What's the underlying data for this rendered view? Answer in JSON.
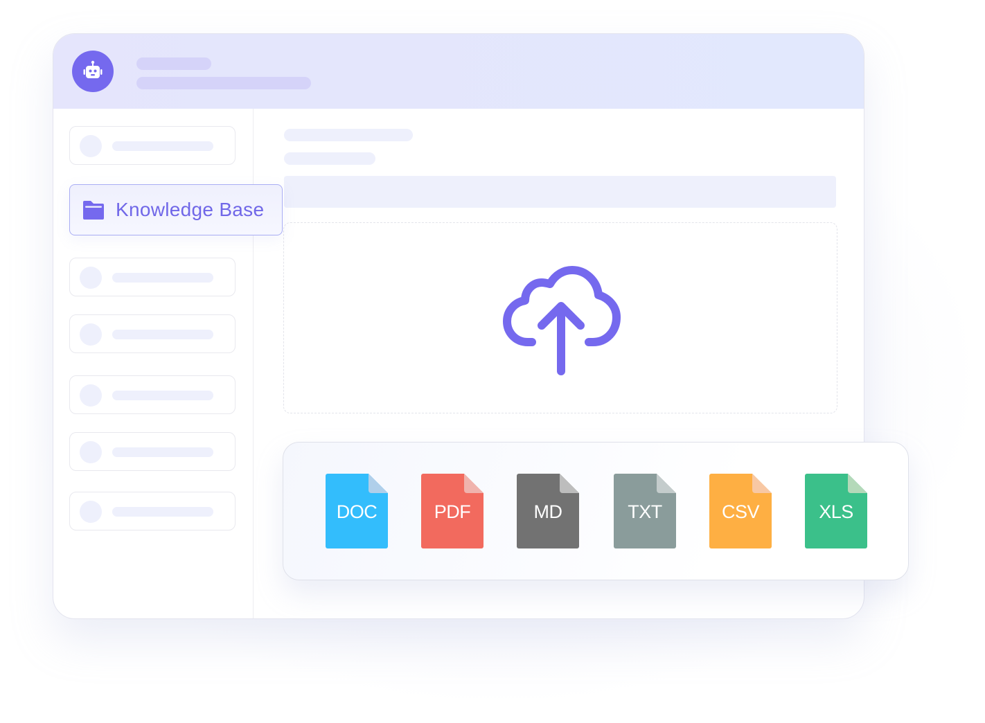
{
  "sidebar": {
    "active_item": {
      "label": "Knowledge Base",
      "icon": "folder-icon"
    },
    "placeholder_items_count": 6
  },
  "header": {
    "avatar_icon": "robot-icon"
  },
  "upload": {
    "icon": "cloud-upload-icon"
  },
  "file_types": [
    {
      "label": "DOC",
      "color": "#33bdfc",
      "fold": "#b0cfea"
    },
    {
      "label": "PDF",
      "color": "#f26a5e",
      "fold": "#f0b3ad"
    },
    {
      "label": "MD",
      "color": "#727272",
      "fold": "#bdbdbd"
    },
    {
      "label": "TXT",
      "color": "#8a9c9b",
      "fold": "#c4cccc"
    },
    {
      "label": "CSV",
      "color": "#feaf43",
      "fold": "#f8c8a4"
    },
    {
      "label": "XLS",
      "color": "#3bc08a",
      "fold": "#b4d9b9"
    }
  ],
  "colors": {
    "accent": "#7569ee",
    "header_bg": "#e5e5fc",
    "skeleton": "#eef0fc"
  }
}
